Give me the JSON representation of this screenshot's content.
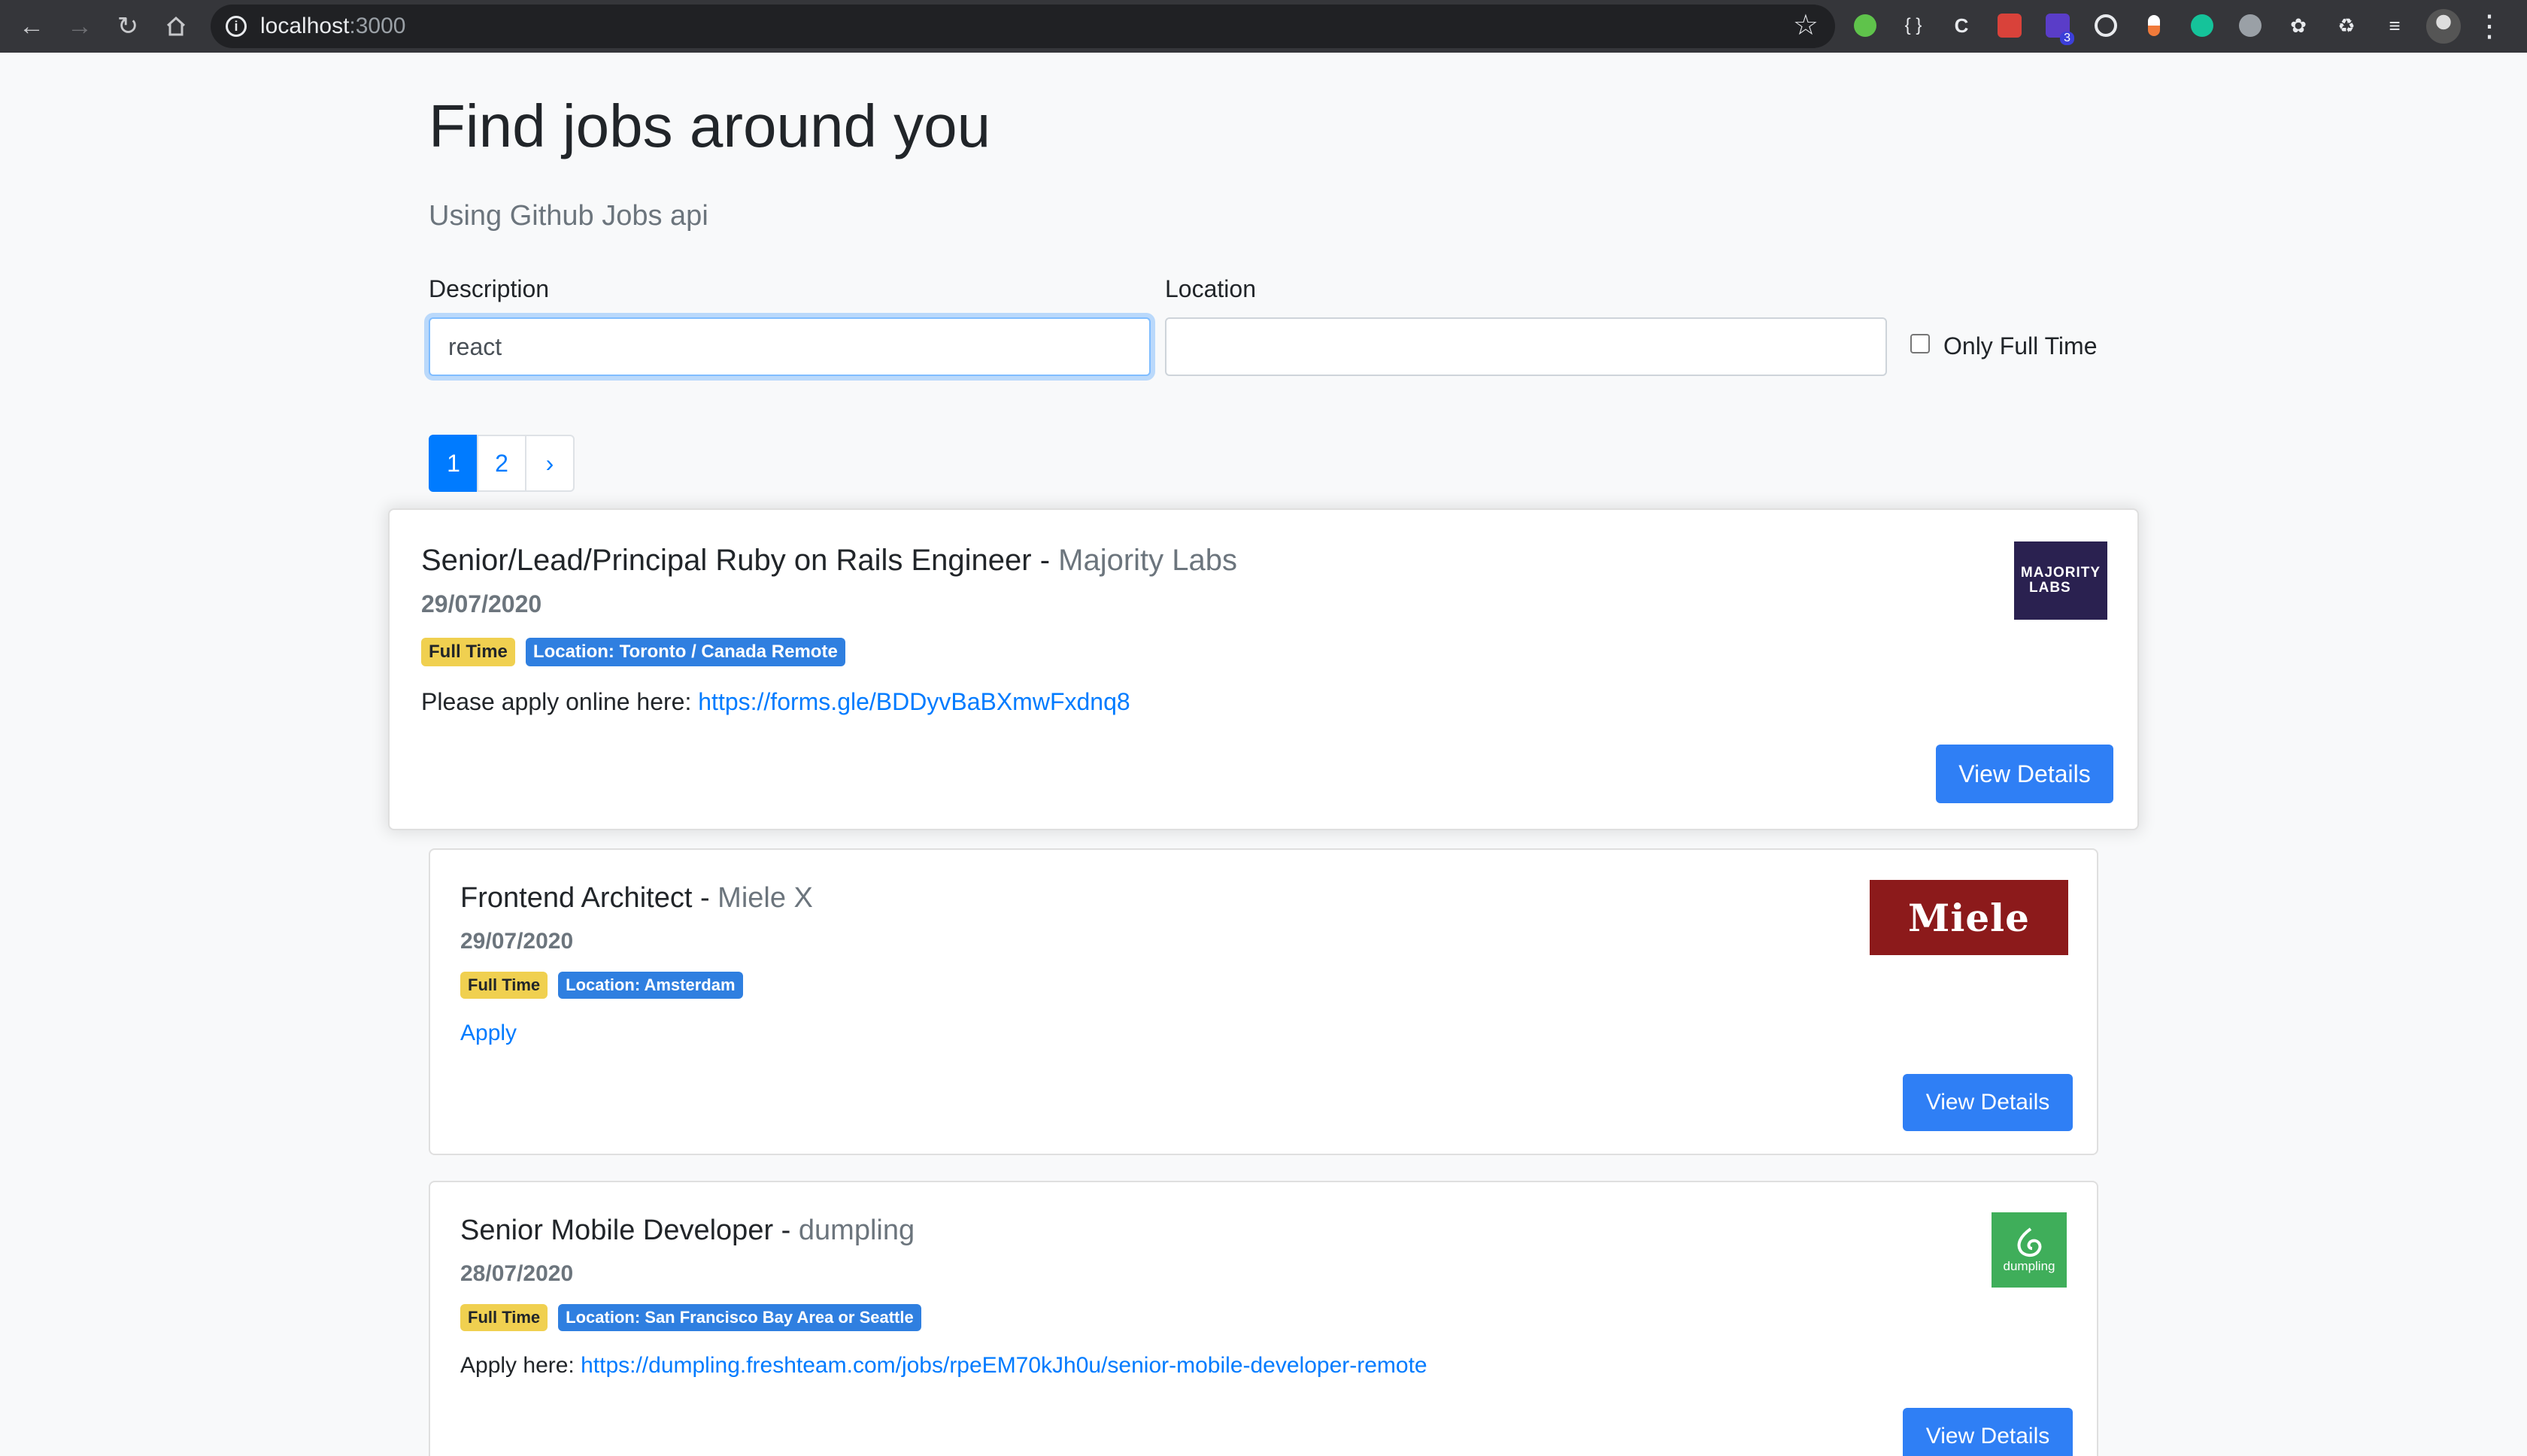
{
  "browser": {
    "url_host": "localhost",
    "url_port": ":3000",
    "extension_badge": "3"
  },
  "header": {
    "title": "Find jobs around you",
    "subtitle": "Using Github Jobs api"
  },
  "search": {
    "description_label": "Description",
    "description_value": "react",
    "location_label": "Location",
    "location_value": "",
    "full_time_label": "Only Full Time",
    "full_time_checked": false
  },
  "pagination": {
    "pages": [
      "1",
      "2"
    ],
    "next": "›",
    "active_page": "1"
  },
  "jobs": [
    {
      "title": "Senior/Lead/Principal Ruby on Rails Engineer",
      "separator": " - ",
      "company": "Majority Labs",
      "date": "29/07/2020",
      "type": "Full Time",
      "location": "Location: Toronto / Canada Remote",
      "apply_prefix": "Please apply online here: ",
      "apply_link": "https://forms.gle/BDDyvBaBXmwFxdnq8",
      "button": "View Details",
      "logo_text_1": "MAJORITY",
      "logo_text_2": "LABS",
      "logo_bg": "#2a2150"
    },
    {
      "title": "Frontend Architect",
      "separator": " - ",
      "company": "Miele X",
      "date": "29/07/2020",
      "type": "Full Time",
      "location": "Location: Amsterdam",
      "apply_prefix": "",
      "apply_link": "Apply",
      "button": "View Details",
      "logo_text": "Miele",
      "logo_bg": "#8c1a1b"
    },
    {
      "title": "Senior Mobile Developer",
      "separator": " - ",
      "company": "dumpling",
      "date": "28/07/2020",
      "type": "Full Time",
      "location": "Location: San Francisco Bay Area or Seattle",
      "apply_prefix": "Apply here: ",
      "apply_link": "https://dumpling.freshteam.com/jobs/rpeEM70kJh0u/senior-mobile-developer-remote",
      "button": "View Details",
      "logo_text": "dumpling",
      "logo_bg": "#3fae5a"
    }
  ]
}
